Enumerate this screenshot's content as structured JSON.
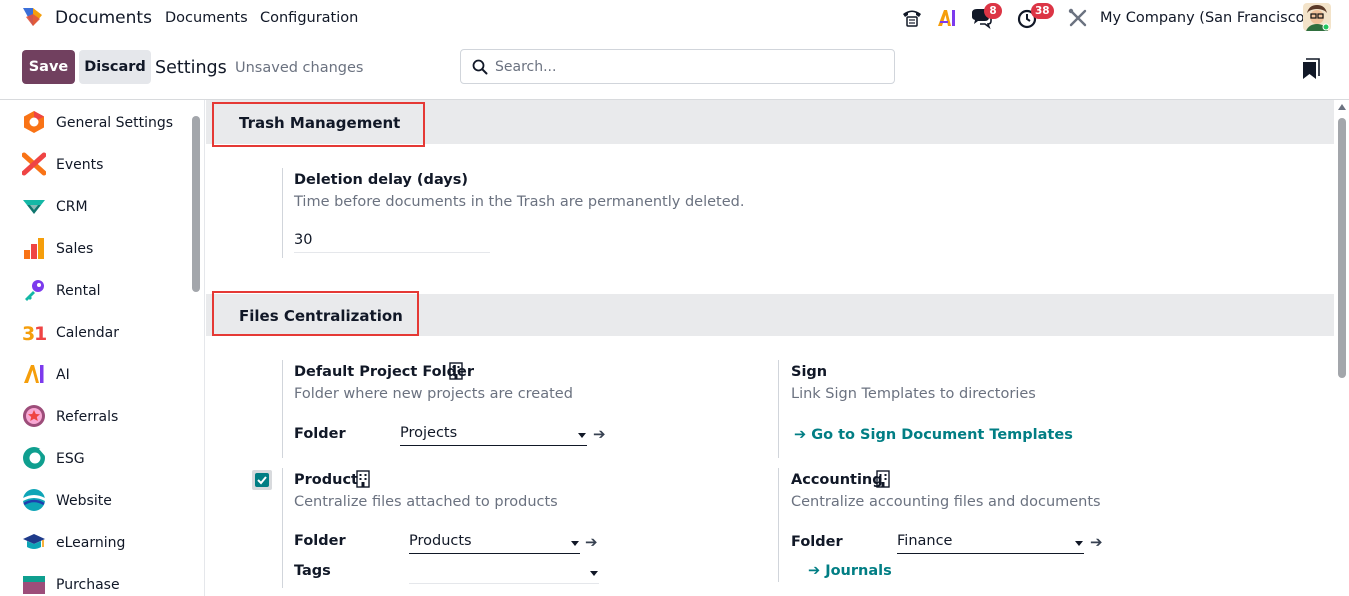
{
  "navbar": {
    "app_name": "Documents",
    "menu": [
      "Documents",
      "Configuration"
    ],
    "icons": [
      "phone-icon",
      "ai-icon",
      "chat-icon",
      "activity-clock-icon",
      "debug-tools-icon"
    ],
    "chat_badge": "8",
    "activity_badge": "38",
    "company": "My Company (San Francisco)",
    "badge_color": "#dc3545"
  },
  "control_panel": {
    "save_label": "Save",
    "discard_label": "Discard",
    "title": "Settings",
    "status": "Unsaved changes",
    "search_placeholder": "Search...",
    "save_color": "#71405f"
  },
  "sidebar": {
    "items": [
      {
        "label": "General Settings",
        "icon": "general-settings-icon"
      },
      {
        "label": "Events",
        "icon": "events-icon"
      },
      {
        "label": "CRM",
        "icon": "crm-icon"
      },
      {
        "label": "Sales",
        "icon": "sales-icon"
      },
      {
        "label": "Rental",
        "icon": "rental-icon"
      },
      {
        "label": "Calendar",
        "icon": "calendar-icon"
      },
      {
        "label": "AI",
        "icon": "ai-app-icon"
      },
      {
        "label": "Referrals",
        "icon": "referrals-icon"
      },
      {
        "label": "ESG",
        "icon": "esg-icon"
      },
      {
        "label": "Website",
        "icon": "website-icon"
      },
      {
        "label": "eLearning",
        "icon": "elearning-icon"
      },
      {
        "label": "Purchase",
        "icon": "purchase-icon"
      }
    ]
  },
  "trash": {
    "title": "Trash Management",
    "setting_title": "Deletion delay (days)",
    "setting_desc": "Time before documents in the Trash are permanently deleted.",
    "value": "30"
  },
  "files": {
    "title": "Files Centralization",
    "default_project": {
      "title": "Default Project Folder",
      "desc": "Folder where new projects are created",
      "folder_label": "Folder",
      "folder_value": "Projects"
    },
    "sign": {
      "title": "Sign",
      "desc": "Link Sign Templates to directories",
      "link": "Go to Sign Document Templates"
    },
    "product": {
      "title": "Product",
      "desc": "Centralize files attached to products",
      "checked": true,
      "folder_label": "Folder",
      "folder_value": "Products",
      "tags_label": "Tags",
      "tags_value": ""
    },
    "accounting": {
      "title": "Accounting",
      "desc": "Centralize accounting files and documents",
      "folder_label": "Folder",
      "folder_value": "Finance",
      "link": "Journals"
    }
  },
  "accent_color": "#017e84",
  "highlight_color": "#e53935"
}
